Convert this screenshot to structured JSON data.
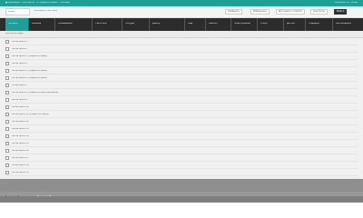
{
  "topbar": {
    "left": "● Брошюра · Контакты · Отправить заказ · Помощь",
    "right": "Корзина (0) · Вход"
  },
  "header": {
    "logo": "LOGO",
    "subtitle": "Интернет-магазин",
    "buttons": [
      "Сравнить",
      "Избранное",
      "Доставка и оплата",
      "Контакты",
      "Войти"
    ]
  },
  "nav": {
    "items": [
      "Каталог",
      "Мебель",
      "Освещение",
      "Текстиль",
      "Посуда",
      "Декор",
      "Сад",
      "Ремонт",
      "Электроника",
      "Спорт",
      "Детям",
      "Подарки",
      "Распродажа"
    ]
  },
  "subrow": {
    "label": "Все категории"
  },
  "list": [
    "Категория 1",
    "Категория 2",
    "Категория 3 (подкатегория)",
    "Категория 4",
    "Категория 5 (подкатегория)",
    "Категория 6 (подкатегория)",
    "Категория 7",
    "Категория 8 (подкатегория длинная)",
    "Категория 9",
    "Категория 10",
    "Категория 11 (подкатегория)",
    "Категория 12",
    "Категория 13",
    "Категория 14",
    "Категория 15",
    "Категория 16",
    "Категория 17",
    "Категория 18",
    "Категория 19"
  ],
  "bottom": {
    "tag": "Главная",
    "tag2": "Каталог"
  },
  "colors": {
    "accent": "#1f9f96",
    "nav_bg": "#2c2c2c",
    "content_bg": "#f0f0f0"
  }
}
